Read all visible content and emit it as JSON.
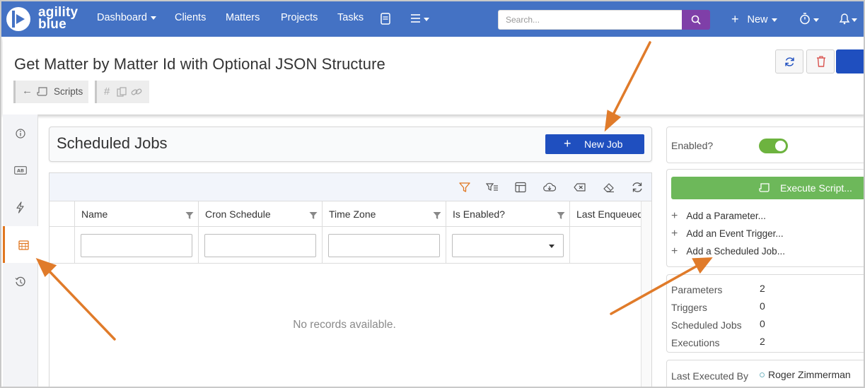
{
  "navbar": {
    "logo_text": [
      "agility",
      "blue"
    ],
    "items": [
      {
        "label": "Dashboard",
        "has_caret": true
      },
      {
        "label": "Clients"
      },
      {
        "label": "Matters"
      },
      {
        "label": "Projects"
      },
      {
        "label": "Tasks"
      }
    ],
    "search_placeholder": "Search...",
    "new_label": "New",
    "icons": [
      "ledger-icon",
      "menu-lines-icon",
      "search-icon",
      "plus-icon",
      "stopwatch-icon",
      "bell-icon"
    ]
  },
  "header": {
    "title": "Get Matter by Matter Id with Optional JSON Structure",
    "breadcrumb_label": "Scripts",
    "colors": {
      "primary": "#1f4fbf",
      "danger": "#d9534f"
    }
  },
  "main": {
    "section_title": "Scheduled Jobs",
    "new_job_label": "New Job",
    "columns": [
      "Name",
      "Cron Schedule",
      "Time Zone",
      "Is Enabled?",
      "Last Enqueued"
    ],
    "empty_text": "No records available."
  },
  "right_panel": {
    "enabled_label": "Enabled?",
    "enabled": true,
    "execute_label": "Execute Script...",
    "actions": [
      "Add a Parameter...",
      "Add an Event Trigger...",
      "Add a Scheduled Job..."
    ],
    "stats": [
      {
        "label": "Parameters",
        "value": "2"
      },
      {
        "label": "Triggers",
        "value": "0"
      },
      {
        "label": "Scheduled Jobs",
        "value": "0"
      },
      {
        "label": "Executions",
        "value": "2"
      }
    ],
    "last_executed_label": "Last Executed By",
    "last_executed_user": "Roger Zimmerman"
  },
  "annotation_color": "#e07b2a"
}
